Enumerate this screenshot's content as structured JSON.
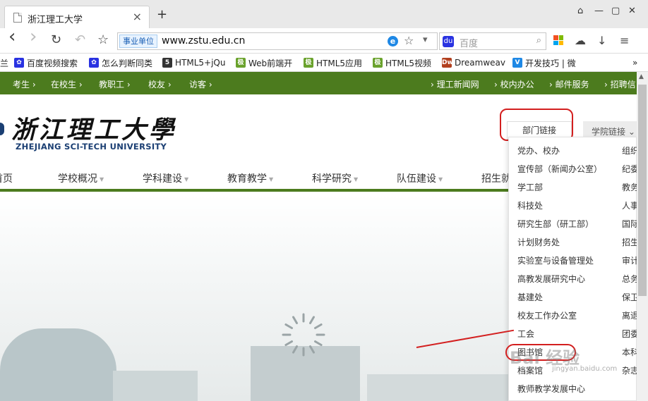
{
  "browser": {
    "tab_title": "浙江理工大学",
    "tab_close": "×",
    "new_tab": "+",
    "url_badge": "事业单位",
    "url": "www.zstu.edu.cn",
    "search_placeholder": "百度",
    "win_controls": [
      "⌂",
      "—",
      "▢",
      "✕"
    ],
    "nav_icons": {
      "back": "‹",
      "forward": "›",
      "reload": "↻",
      "undo": "↶",
      "bookmark": "☆"
    }
  },
  "bookmarks": [
    {
      "label": "兰",
      "icon": ""
    },
    {
      "label": "百度视频搜索",
      "icon": "paw-icon"
    },
    {
      "label": "怎么判断同类",
      "icon": "paw-icon"
    },
    {
      "label": "HTML5+jQu",
      "icon": "html5-icon"
    },
    {
      "label": "Web前端开",
      "icon": "green-icon"
    },
    {
      "label": "HTML5应用",
      "icon": "green-icon"
    },
    {
      "label": "HTML5视频",
      "icon": "green-icon"
    },
    {
      "label": "Dreamweav",
      "icon": "dw-icon"
    },
    {
      "label": "开发技巧 | 微",
      "icon": "v-icon"
    },
    {
      "label": "»",
      "icon": ""
    }
  ],
  "topnav": {
    "left": [
      "考生",
      "在校生",
      "教职工",
      "校友",
      "访客"
    ],
    "right": [
      "理工新闻网",
      "校内办公",
      "邮件服务",
      "招聘信"
    ]
  },
  "header": {
    "logo_cn": "浙江理工大學",
    "logo_en": "ZHEJIANG SCI-TECH UNIVERSITY",
    "dept_button": "部门链接",
    "college_button": "学院链接"
  },
  "mainnav": [
    "首页",
    "学校概况",
    "学科建设",
    "教育教学",
    "科学研究",
    "队伍建设",
    "招生就"
  ],
  "dropdown": {
    "col1": [
      "党办、校办",
      "宣传部（新闻办公室）",
      "学工部",
      "科技处",
      "研究生部（研工部）",
      "计划财务处",
      "实验室与设备管理处",
      "高教发展研究中心",
      "基建处",
      "校友工作办公室",
      "工会",
      "图书馆",
      "档案馆",
      "教师教学发展中心"
    ],
    "col2": [
      "组织",
      "纪委",
      "教务",
      "人事",
      "国际",
      "招生",
      "审计",
      "总务",
      "保卫",
      "离退",
      "团委",
      "本科",
      "杂志"
    ]
  },
  "watermark": {
    "text": "Bai 经验",
    "sub": "jingyan.baidu.com"
  },
  "colors": {
    "brand_green": "#4c7b1e",
    "annotation_red": "#d31f1f"
  }
}
